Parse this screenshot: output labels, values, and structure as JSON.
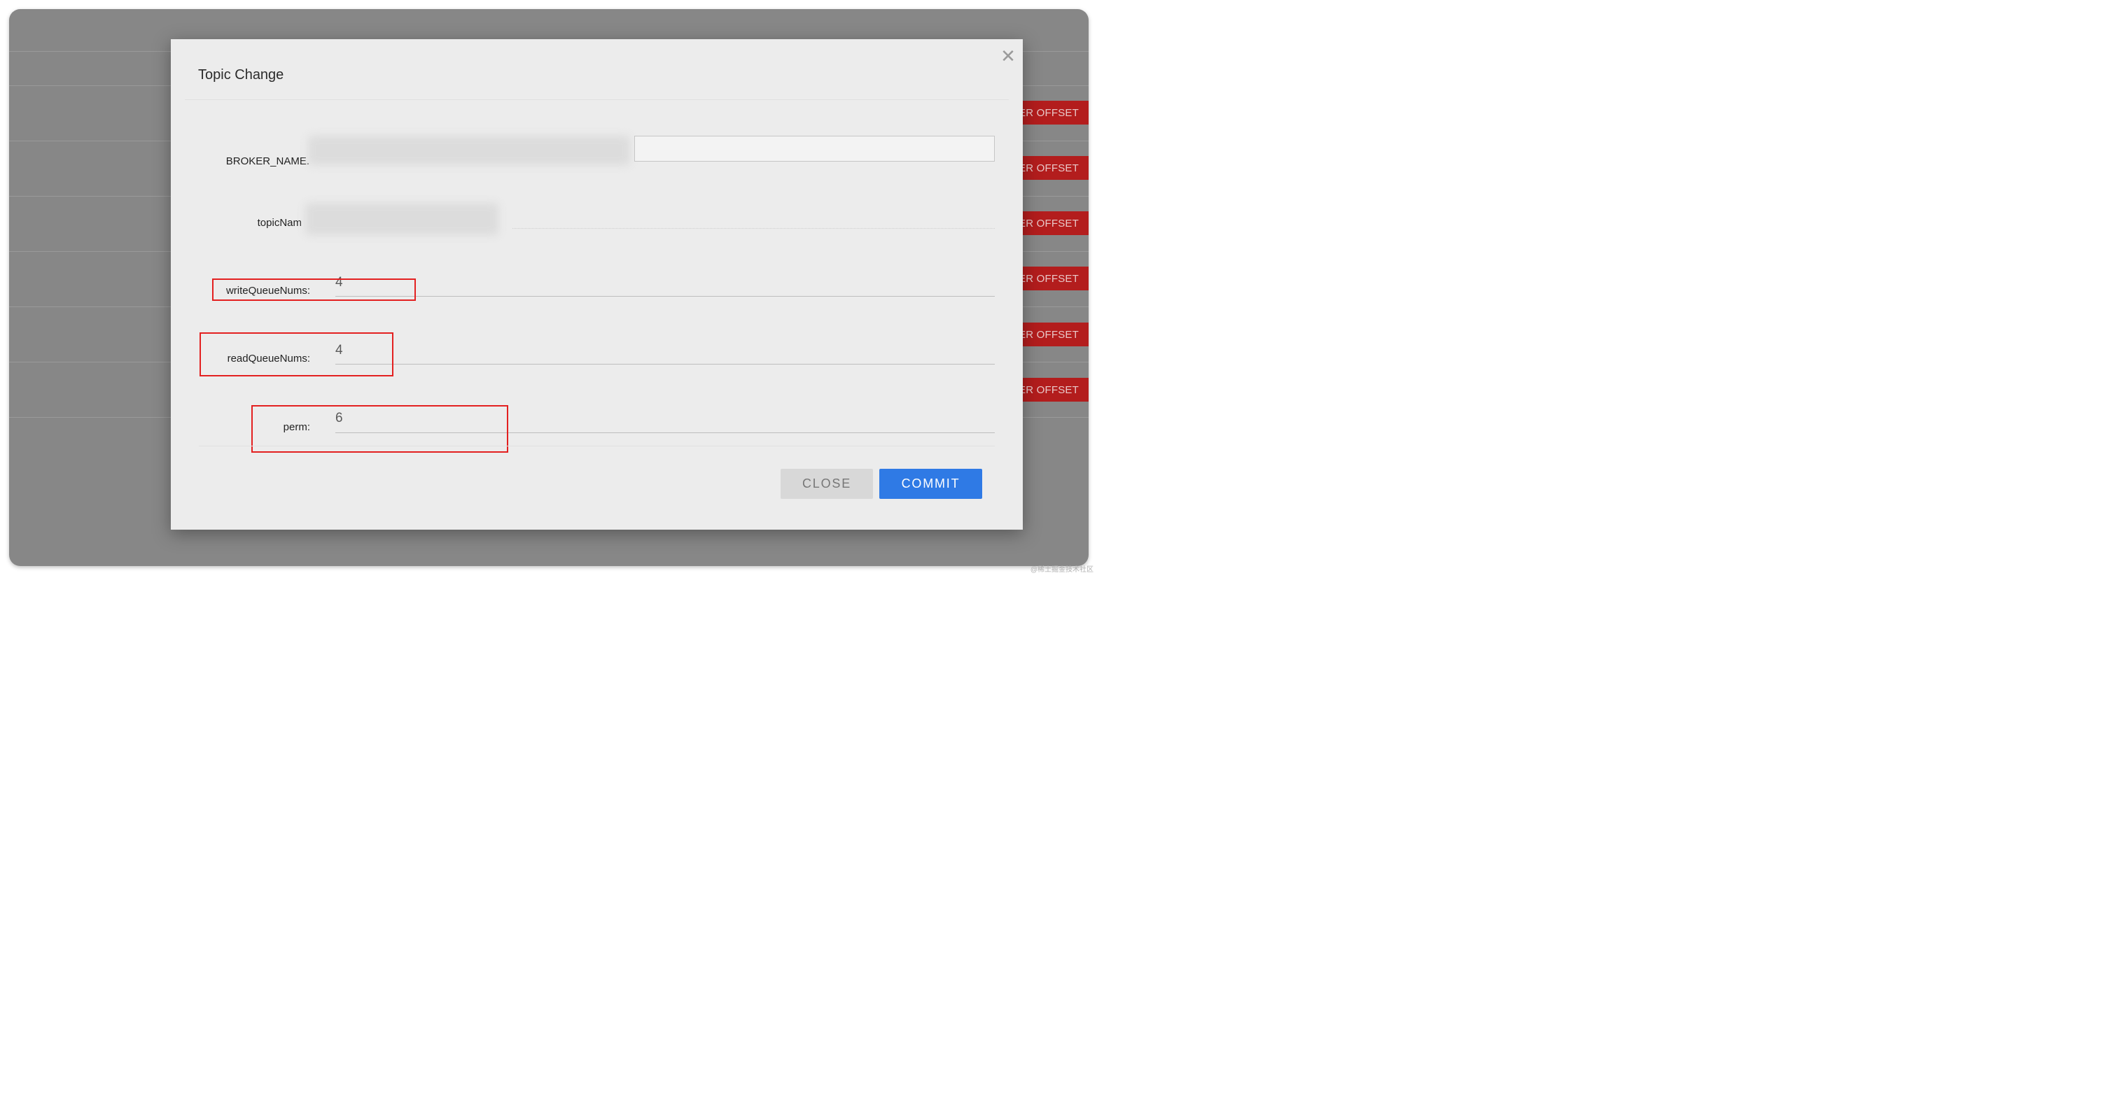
{
  "background": {
    "row_button_label": "ER OFFSET",
    "row_button_count": 6
  },
  "modal": {
    "title": "Topic Change",
    "close_icon": "close-icon",
    "fields": {
      "broker_name": {
        "label": "BROKER_NAME."
      },
      "topic_name": {
        "label": "topicNam"
      },
      "write_queue_nums": {
        "label": "writeQueueNums:",
        "value": "4"
      },
      "read_queue_nums": {
        "label": "readQueueNums:",
        "value": "4"
      },
      "perm": {
        "label": "perm:",
        "value": "6"
      }
    },
    "buttons": {
      "close": "CLOSE",
      "commit": "COMMIT"
    }
  },
  "colors": {
    "primary_button": "#2f7ae5",
    "danger_button": "#b31d1d",
    "highlight_box": "#e32020",
    "overlay": "#878787"
  },
  "watermark": "@稀土掘金技术社区"
}
